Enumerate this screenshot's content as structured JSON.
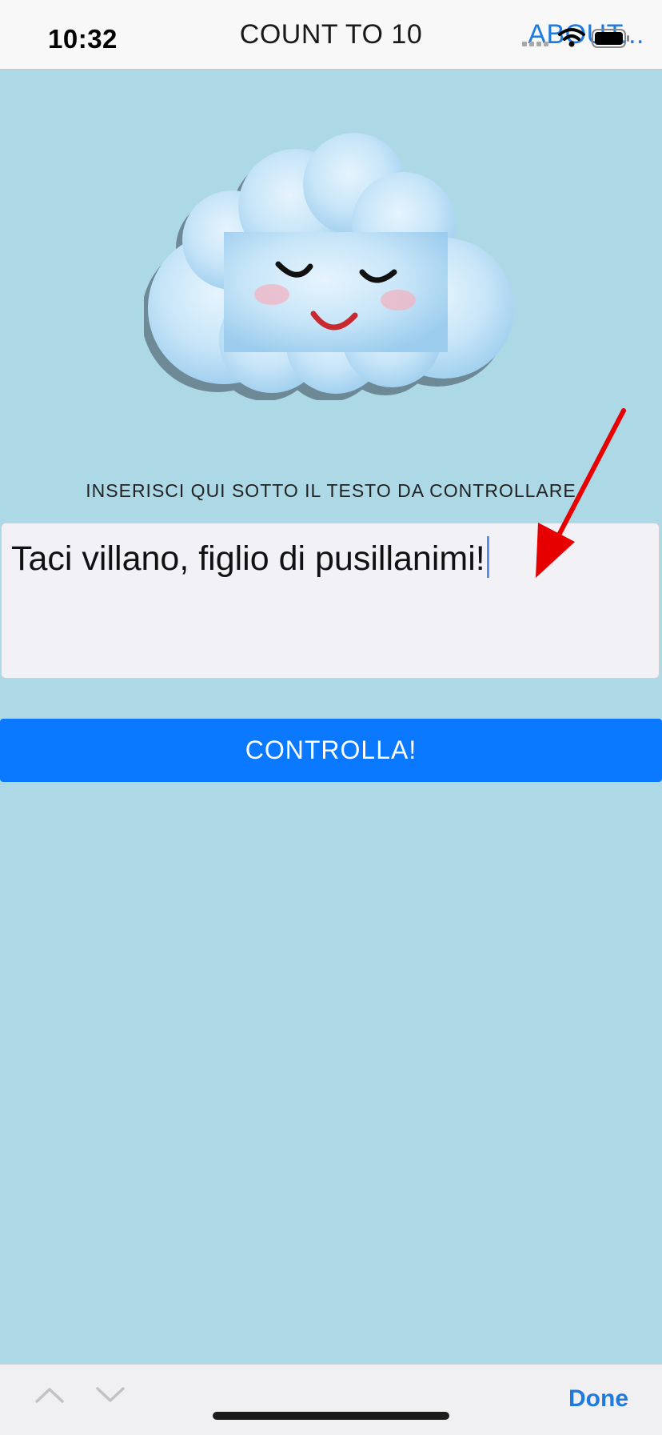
{
  "status_bar": {
    "time": "10:32"
  },
  "nav": {
    "title": "COUNT TO 10",
    "about_link": "ABOUT..."
  },
  "form": {
    "label": "INSERISCI QUI SOTTO IL TESTO DA CONTROLLARE",
    "text_value": "Taci villano, figlio di pusillanimi!",
    "check_button": "CONTROLLA!"
  },
  "keyboard_accessory": {
    "done_label": "Done",
    "up_icon": "chevron-up-icon",
    "down_icon": "chevron-down-icon"
  },
  "colors": {
    "background": "#add8e6",
    "button": "#0a78ff",
    "link": "#1f7ae0",
    "arrow": "#e60000"
  }
}
